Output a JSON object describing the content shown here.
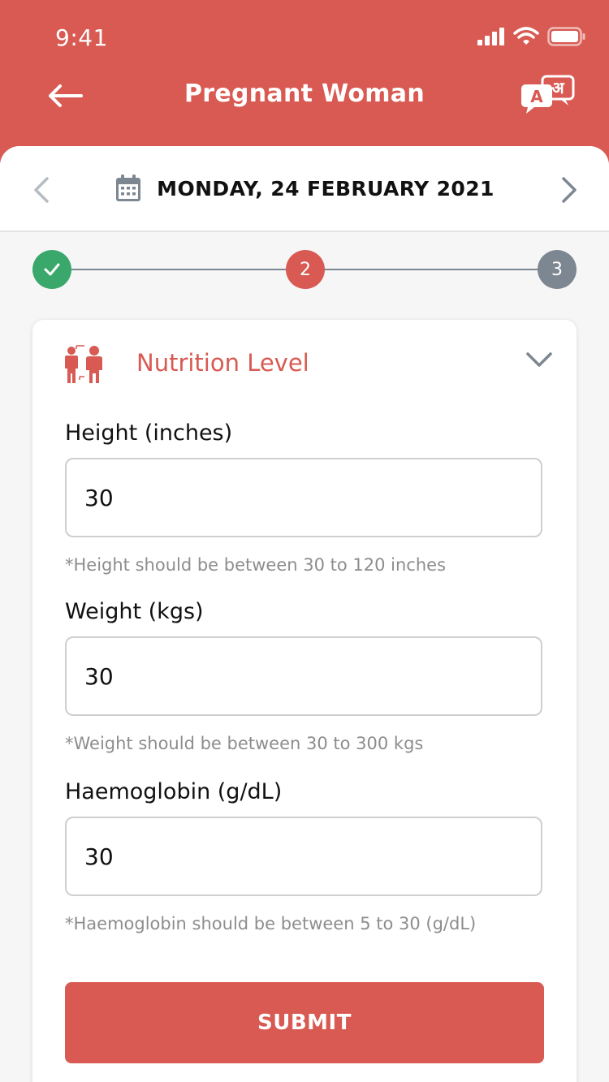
{
  "status_bar": {
    "time": "9:41"
  },
  "header": {
    "title": "Pregnant Woman"
  },
  "date_bar": {
    "date": "MONDAY, 24 FEBRUARY 2021"
  },
  "stepper": {
    "steps": [
      {
        "label": "",
        "state": "completed",
        "color": "#3aa86a"
      },
      {
        "label": "2",
        "state": "current",
        "color": "#d85a52"
      },
      {
        "label": "3",
        "state": "upcoming",
        "color": "#7c8792"
      }
    ]
  },
  "section": {
    "title": "Nutrition Level",
    "fields": [
      {
        "label": "Height (inches)",
        "value": "30",
        "hint": "*Height should be between 30 to 120 inches"
      },
      {
        "label": "Weight (kgs)",
        "value": "30",
        "hint": "*Weight should be between 30 to 300 kgs"
      },
      {
        "label": "Haemoglobin (g/dL)",
        "value": "30",
        "hint": "*Haemoglobin should be between 5 to 30 (g/dL)"
      }
    ],
    "submit_label": "SUBMIT"
  },
  "colors": {
    "primary": "#d85a52",
    "success": "#3aa86a",
    "muted": "#7c8792"
  },
  "icons": [
    "signal-icon",
    "wifi-icon",
    "battery-icon",
    "back-arrow-icon",
    "translate-icon",
    "chevron-left-icon",
    "calendar-icon",
    "chevron-right-icon",
    "check-icon",
    "nutrition-icon",
    "chevron-down-icon"
  ]
}
